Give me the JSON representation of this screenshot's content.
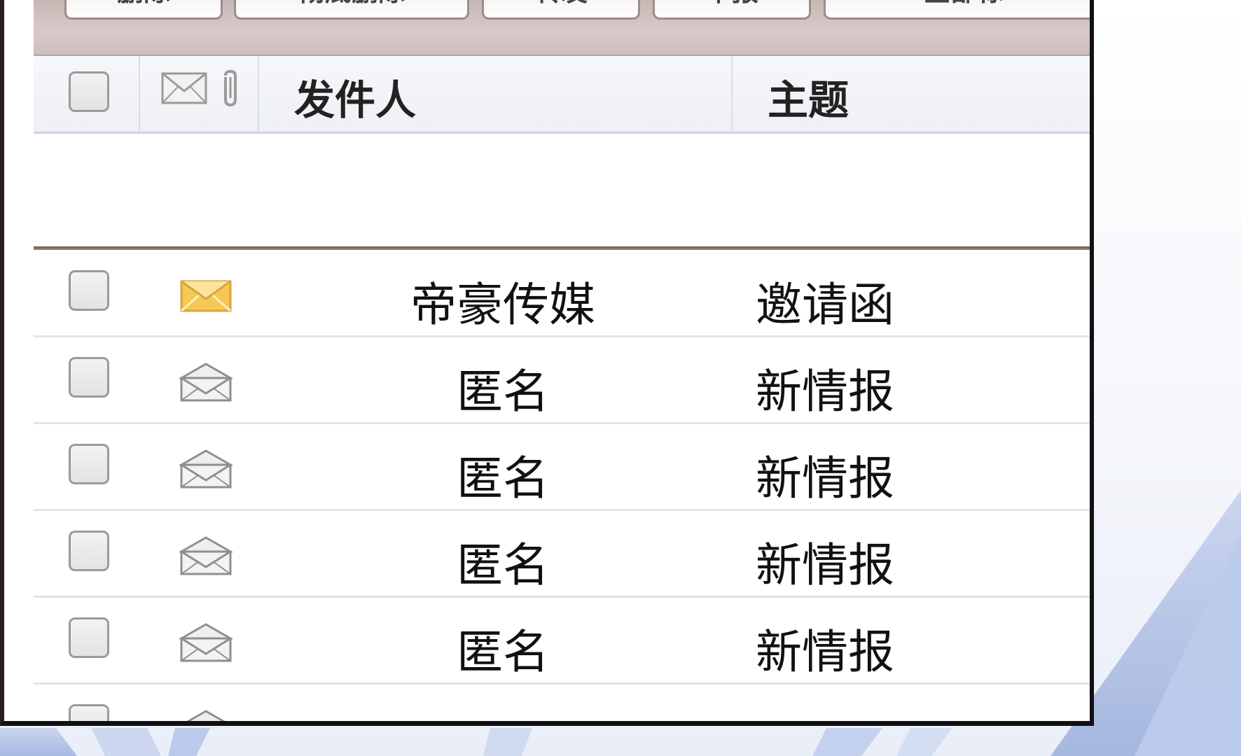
{
  "toolbar": {
    "buttons": [
      "删除",
      "彻底删除",
      "转发",
      "举报",
      "全部标"
    ]
  },
  "header": {
    "sender_label": "发件人",
    "subject_label": "主题"
  },
  "icons": {
    "envelope_header": "envelope-icon",
    "attachment_header": "paperclip-icon",
    "unread": "envelope-closed-icon",
    "read": "envelope-open-icon"
  },
  "colors": {
    "unread_envelope": "#f5c855",
    "toolbar_bg": "#cfc0be",
    "divider": "#7a5b55"
  },
  "messages": [
    {
      "sender": "帝豪传媒",
      "subject": "邀请函",
      "status": "unread"
    },
    {
      "sender": "匿名",
      "subject": "新情报",
      "status": "read"
    },
    {
      "sender": "匿名",
      "subject": "新情报",
      "status": "read"
    },
    {
      "sender": "匿名",
      "subject": "新情报",
      "status": "read"
    },
    {
      "sender": "匿名",
      "subject": "新情报",
      "status": "read"
    }
  ]
}
